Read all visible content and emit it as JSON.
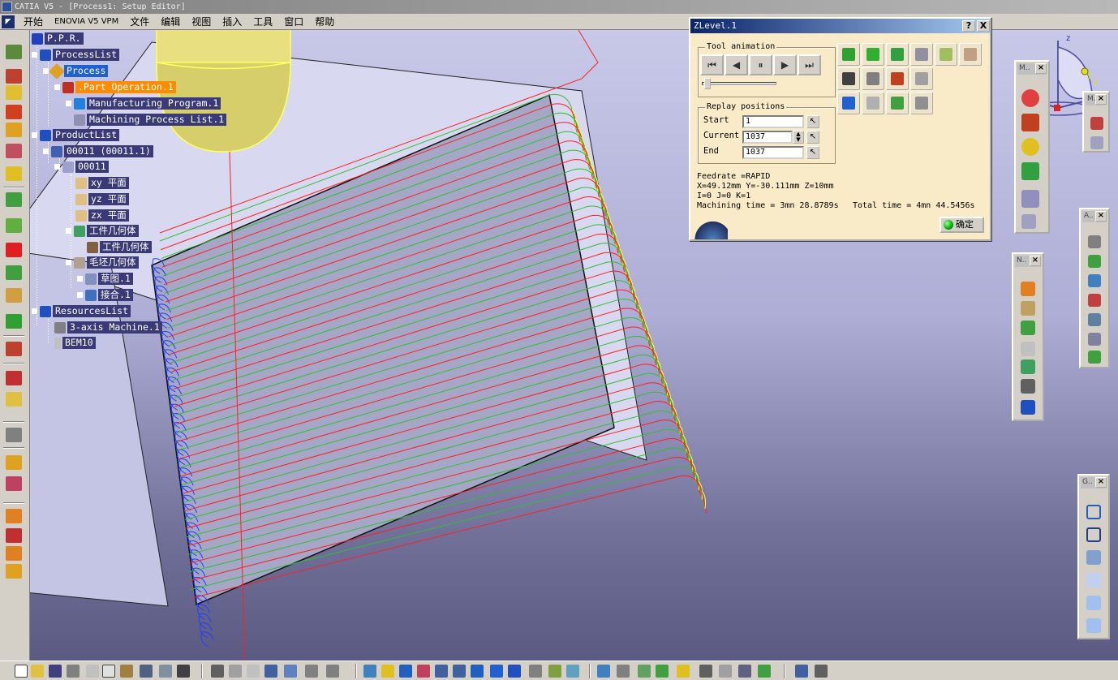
{
  "window": {
    "title": "CATIA V5 - [Process1: Setup Editor]"
  },
  "menu": {
    "items": [
      "开始",
      "ENOVIA V5 VPM",
      "文件",
      "编辑",
      "视图",
      "插入",
      "工具",
      "窗口",
      "帮助"
    ]
  },
  "tree": {
    "ppr": "P.P.R.",
    "process_list": "ProcessList",
    "process": "Process",
    "part_operation": ".Part Operation.1",
    "manufacturing_program": "Manufacturing Program.1",
    "machining_process_list": "Machining Process List.1",
    "product_list": "ProductList",
    "product_instance": "00011 (00011.1)",
    "product": "00011",
    "xy_plane": "xy 平面",
    "yz_plane": "yz 平面",
    "zx_plane": "zx 平面",
    "workpiece_body": "工件几何体",
    "workpiece_geometry": "工件几何体",
    "stock_body": "毛坯几何体",
    "sketch": "草图.1",
    "join": "接合.1",
    "resources_list": "ResourcesList",
    "machine": "3-axis Machine.1",
    "tool": "BEM10"
  },
  "dialog": {
    "title": "ZLevel.1",
    "help_btn": "?",
    "close_btn": "X",
    "tool_animation_label": "Tool animation",
    "replay_positions_label": "Replay positions",
    "start_label": "Start",
    "start_value": "1",
    "current_label": "Current",
    "current_value": "1037",
    "end_label": "End",
    "end_value": "1037",
    "animation_progress": 0.03,
    "feedrate": "Feedrate =RAPID",
    "position": "X=49.12mm Y=-30.111mm Z=10mm",
    "direction": "I=0 J=0 K=1",
    "machining_time": "Machining time = 3mn 28.8789s",
    "total_time": "Total time = 4mn 44.5456s",
    "ok_label": "确定",
    "transport": [
      "rewind",
      "step-back",
      "pause",
      "step-forward",
      "fast-forward"
    ]
  },
  "palettes": [
    {
      "id": "m",
      "title": "M.."
    },
    {
      "id": "m2",
      "title": "M.."
    },
    {
      "id": "a",
      "title": "A.."
    },
    {
      "id": "n",
      "title": "N.."
    },
    {
      "id": "g",
      "title": "G.."
    }
  ],
  "compass": {
    "z_label": "z",
    "x_label": "x",
    "y_label": "y"
  },
  "colors": {
    "viewport_top": "#c8c8e8",
    "tree_label_bg": "#3a3a78",
    "selected_orange": "#ff8c00",
    "dialog_bg": "#faebc8",
    "toolpath_red": "#ff2020",
    "toolpath_green": "#30c030",
    "toolpath_yellow": "#ffff40",
    "toolpath_blue": "#2040ff"
  }
}
